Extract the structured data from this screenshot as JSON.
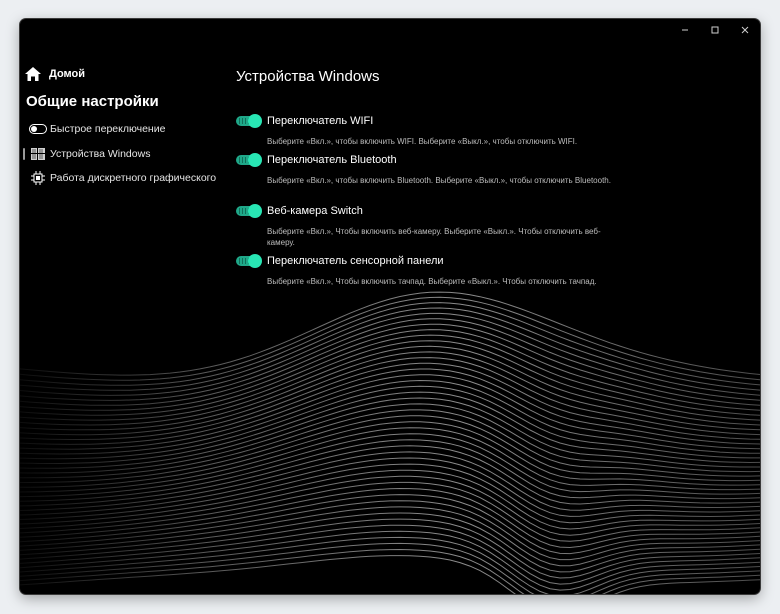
{
  "window_controls": {
    "minimize_icon": "minimize-icon",
    "maximize_icon": "maximize-icon",
    "close_icon": "close-icon"
  },
  "sidebar": {
    "home_label": "Домой",
    "section_title": "Общие настройки",
    "items": [
      {
        "label": "Быстрое переключение",
        "icon": "toggle-icon",
        "active": false
      },
      {
        "label": "Устройства Windows",
        "icon": "windows-device-icon",
        "active": true
      },
      {
        "label": "Работа дискретного графического пр",
        "icon": "chip-icon",
        "active": false
      }
    ]
  },
  "main": {
    "title": "Устройства Windows",
    "settings": [
      {
        "label": "Переключатель WIFI",
        "description": "Выберите «Вкл.», чтобы включить WIFI. Выберите «Выкл.», чтобы отключить WIFI.",
        "enabled": true
      },
      {
        "label": "Переключатель Bluetooth",
        "description": "Выберите «Вкл.», чтобы включить Bluetooth. Выберите «Выкл.», чтобы отключить Bluetooth.",
        "enabled": true
      },
      {
        "label": "Веб-камера Switch",
        "description": "Выберите «Вкл.», Чтобы включить веб-камеру. Выберите «Выкл.». Чтобы отключить веб-камеру.",
        "enabled": true
      },
      {
        "label": "Переключатель сенсорной панели",
        "description": "Выберите «Вкл.», Чтобы включить тачпад. Выберите «Выкл.». Чтобы отключить тачпад.",
        "enabled": true
      }
    ]
  },
  "colors": {
    "background": "#000000",
    "toggle_on": "#28e6b4",
    "toggle_track": "#1fa889"
  }
}
